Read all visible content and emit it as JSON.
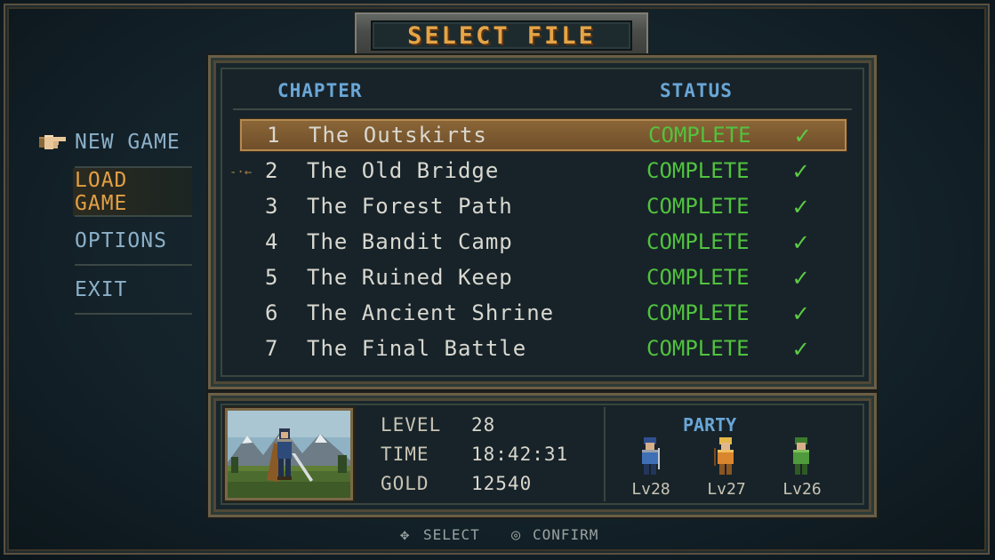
{
  "title": "SELECT FILE",
  "menu": {
    "items": [
      {
        "label": "NEW GAME",
        "color": "#8bb0c8"
      },
      {
        "label": "LOAD GAME",
        "color": "#e3a044"
      },
      {
        "label": "OPTIONS",
        "color": "#8bb0c8"
      },
      {
        "label": "EXIT",
        "color": "#8bb0c8"
      }
    ],
    "cursor_icon": "pointing-hand-icon"
  },
  "list": {
    "headers": {
      "chapter": "CHAPTER",
      "status": "STATUS"
    },
    "rows": [
      {
        "num": "1",
        "name": "The Outskirts",
        "status": "COMPLETE",
        "icon": "checkmark-icon"
      },
      {
        "num": "2",
        "name": "The Old Bridge",
        "status": "COMPLETE",
        "icon": "checkmark-icon"
      },
      {
        "num": "3",
        "name": "The Forest Path",
        "status": "COMPLETE",
        "icon": "checkmark-icon"
      },
      {
        "num": "4",
        "name": "The Bandit Camp",
        "status": "COMPLETE",
        "icon": "checkmark-icon"
      },
      {
        "num": "5",
        "name": "The Ruined Keep",
        "status": "COMPLETE",
        "icon": "checkmark-icon"
      },
      {
        "num": "6",
        "name": "The Ancient Shrine",
        "status": "COMPLETE",
        "icon": "checkmark-icon"
      },
      {
        "num": "7",
        "name": "The Final Battle",
        "status": "COMPLETE",
        "icon": "checkmark-icon"
      }
    ],
    "selected_index": 0
  },
  "save_info": {
    "level_label": "LEVEL",
    "level_value": "28",
    "time_label": "TIME",
    "time_value": "18:42:31",
    "gold_label": "GOLD",
    "gold_value": "12540"
  },
  "party": {
    "title": "PARTY",
    "members": [
      {
        "lv": "Lv28",
        "color": "#3f6fb5"
      },
      {
        "lv": "Lv27",
        "color": "#d9862e"
      },
      {
        "lv": "Lv26",
        "color": "#4f9a3c"
      }
    ]
  },
  "footer": {
    "select_label": "SELECT",
    "confirm_label": "CONFIRM",
    "select_icon": "dpad-icon",
    "confirm_icon": "circle-button-icon"
  },
  "colors": {
    "accent": "#e3a044",
    "status_complete": "#52c23e",
    "header": "#6aa6d6"
  }
}
